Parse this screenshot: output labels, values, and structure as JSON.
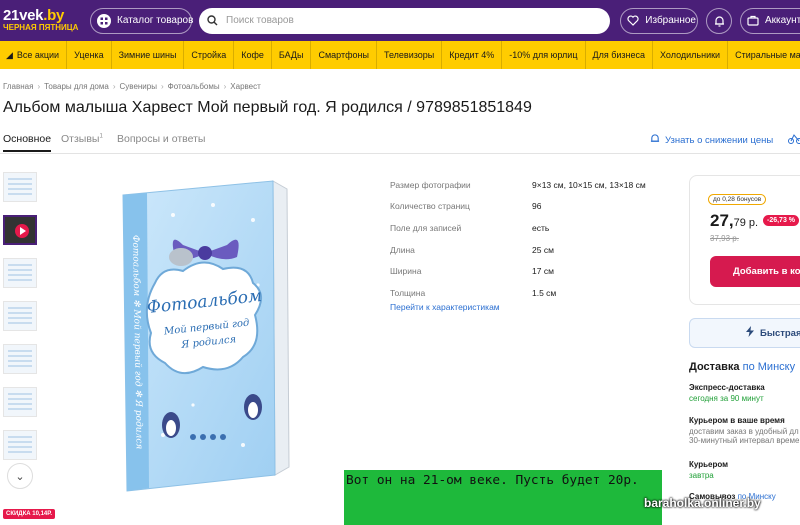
{
  "header": {
    "logo_line1_a": "21vek",
    "logo_line1_b": ".by",
    "logo_line2": "ЧЕРНАЯ ПЯТНИЦА",
    "catalog_label": "Каталог товаров",
    "search_placeholder": "Поиск товаров",
    "favorites_label": "Избранное",
    "account_label": "Аккаунт",
    "colors": {
      "header_bg": "#4a1f78",
      "nav_bg": "#ffcc00",
      "accent": "#d61a4f",
      "link": "#2b6fd1",
      "green": "#21a038"
    }
  },
  "nav": {
    "items": [
      "Все акции",
      "Уценка",
      "Зимние шины",
      "Стройка",
      "Кофе",
      "БАДы",
      "Смартфоны",
      "Телевизоры",
      "Кредит 4%",
      "-10% для юрлиц",
      "Для бизнеса",
      "Холодильники",
      "Стиральные машины"
    ]
  },
  "breadcrumbs": [
    "Главная",
    "Товары для дома",
    "Сувениры",
    "Фотоальбомы",
    "Харвест"
  ],
  "product": {
    "title": "Альбом малыша Харвест Мой первый год. Я родился / 9789851851849"
  },
  "tabs": {
    "main": "Основное",
    "reviews": "Отзывы",
    "reviews_count": "1",
    "questions": "Вопросы и ответы",
    "notify": "Узнать о снижении цены"
  },
  "gallery": {
    "discount_tag": "СКИДКА 10,14Р.",
    "cover_title": "Фотоальбом",
    "cover_subtitle_1": "Мой первый год",
    "cover_subtitle_2": "Я родился",
    "spine_text": "Фотоальбом ✻ Мой первый год ✻ Я родился"
  },
  "specs": {
    "rows": [
      {
        "k": "Размер фотографии",
        "v": "9×13 см, 10×15 см, 13×18 см"
      },
      {
        "k": "Количество страниц",
        "v": "96"
      },
      {
        "k": "Поле для записей",
        "v": "есть"
      },
      {
        "k": "Длина",
        "v": "25 см"
      },
      {
        "k": "Ширина",
        "v": "17 см"
      },
      {
        "k": "Толщина",
        "v": "1.5 см"
      }
    ],
    "link": "Перейти к характеристикам"
  },
  "price": {
    "bonus": "до 0,28 бонусов",
    "main": "27,",
    "cents": "79 р.",
    "discount_pct": "-26,73 %",
    "old": "37,93 р.",
    "add_to_cart": "Добавить в кор"
  },
  "quick_buy": "Быстрая",
  "delivery": {
    "title": "Доставка",
    "city": "по Минску",
    "express_title": "Экспресс-доставка",
    "express_time": "сегодня за 90 минут",
    "courier_time_title": "Курьером в ваше время",
    "courier_time_desc1": "доставим заказ в удобный дл",
    "courier_time_desc2": "30-минутный интервал време",
    "courier_title": "Курьером",
    "courier_when": "завтра",
    "pickup_title": "Самовывоз",
    "pickup_city": "по Минску"
  },
  "overlay": {
    "comment": "Вот он на 21-ом веке. Пусть будет 20р.",
    "watermark": "baraholka.onliner.by"
  }
}
